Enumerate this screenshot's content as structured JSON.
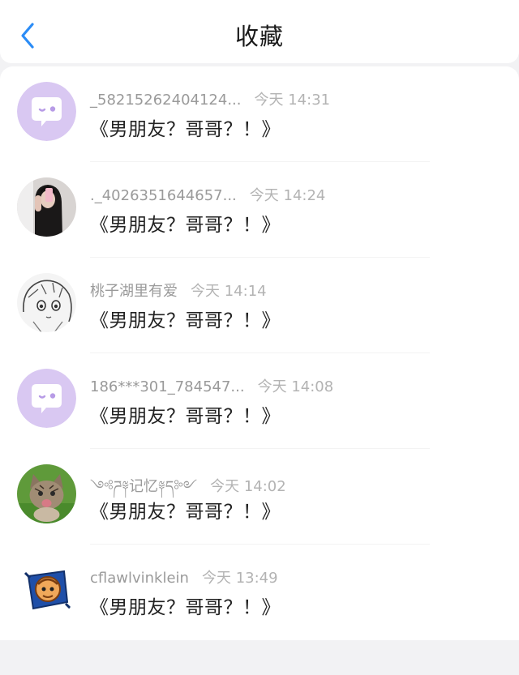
{
  "header": {
    "title": "收藏",
    "back_icon": "chevron-left-icon",
    "accent_color": "#2b8cf6"
  },
  "items": [
    {
      "username": "_58215262404124...",
      "time": "今天 14:31",
      "content": "《男朋友？哥哥？！》",
      "avatar": "default-chat-avatar"
    },
    {
      "username": "._4026351644657...",
      "time": "今天 14:24",
      "content": "《男朋友？哥哥？！》",
      "avatar": "photo-avatar-girl-phone"
    },
    {
      "username": "桃子湖里有爱",
      "time": "今天 14:14",
      "content": "《男朋友？哥哥？！》",
      "avatar": "anime-sketch-avatar"
    },
    {
      "username": "186***301_784547...",
      "time": "今天 14:08",
      "content": "《男朋友？哥哥？！》",
      "avatar": "default-chat-avatar"
    },
    {
      "username": "༺ཌ༈记忆༈ད༻",
      "time": "今天 14:02",
      "content": "《男朋友？哥哥？！》",
      "avatar": "kitten-photo-avatar"
    },
    {
      "username": "cflawlvinklein",
      "time": "今天 13:49",
      "content": "《男朋友？哥哥？！》",
      "avatar": "cartoon-badge-avatar"
    }
  ]
}
